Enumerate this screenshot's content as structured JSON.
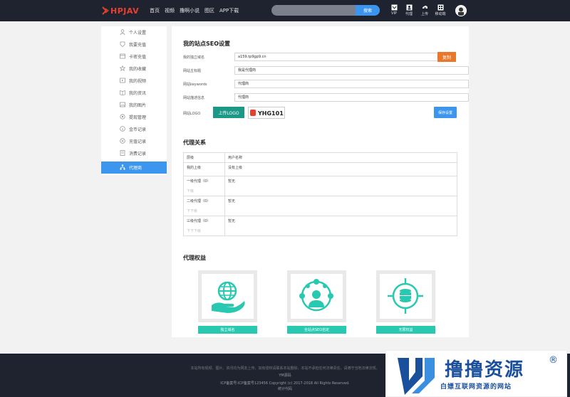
{
  "header": {
    "logo_text": "HPJAV",
    "nav": [
      "首页",
      "视频",
      "撸啊小说",
      "图区",
      "APP下载"
    ],
    "search": {
      "placeholder": "",
      "button_label": "搜索"
    },
    "tools": [
      {
        "icon": "vip-icon",
        "label": "VIP"
      },
      {
        "icon": "agent-icon",
        "label": "代理"
      },
      {
        "icon": "upload-icon",
        "label": "上传"
      },
      {
        "icon": "mobile-icon",
        "label": "移动端"
      }
    ]
  },
  "sidebar": {
    "items": [
      {
        "icon": "user-icon",
        "label": "个人设置"
      },
      {
        "icon": "vip-badge-icon",
        "label": "我要充值"
      },
      {
        "icon": "card-icon",
        "label": "卡密充值"
      },
      {
        "icon": "star-icon",
        "label": "我的收藏"
      },
      {
        "icon": "video-icon",
        "label": "我的视频"
      },
      {
        "icon": "book-icon",
        "label": "我的资讯"
      },
      {
        "icon": "image-icon",
        "label": "我的图片"
      },
      {
        "icon": "gear-icon",
        "label": "提现管理"
      },
      {
        "icon": "coin-icon",
        "label": "金币记录"
      },
      {
        "icon": "yen-icon",
        "label": "充值记录"
      },
      {
        "icon": "receipt-icon",
        "label": "消费记录"
      },
      {
        "icon": "network-icon",
        "label": "代理商"
      }
    ],
    "active_index": 11
  },
  "seo": {
    "title": "我的站点SEO设置",
    "fields": [
      {
        "label": "我的独立域名",
        "value": "a159.tp9gp9.cn"
      },
      {
        "label": "网站主标题",
        "value": "我是代理商"
      },
      {
        "label": "网站keywords",
        "value": "代理商"
      },
      {
        "label": "网站描述信息",
        "value": "代理商"
      }
    ],
    "copy_label": "复制",
    "logo_label": "网站LOGO",
    "upload_label": "上传LOGO",
    "logo_preview_text": "YHG101",
    "save_label": "保存设置"
  },
  "relation": {
    "title": "代理关系",
    "headers": [
      "层级",
      "用户名称"
    ],
    "rows": [
      {
        "level": "我的上级",
        "sub": "",
        "name": "没有上级"
      },
      {
        "level": "一级代理（0）",
        "sub": "下级",
        "name": "暂无"
      },
      {
        "level": "二级代理（0）",
        "sub": "下下级",
        "name": "暂无"
      },
      {
        "level": "三级代理（0）",
        "sub": "下下下级",
        "name": "暂无"
      }
    ]
  },
  "benefits": {
    "title": "代理权益",
    "cards": [
      {
        "icon": "globe-hand-icon",
        "label": "独立域名"
      },
      {
        "icon": "network-user-icon",
        "label": "全站点SEO自定"
      },
      {
        "icon": "database-target-icon",
        "label": "无限权益"
      }
    ]
  },
  "footer": {
    "lines": [
      "本站所有视频、图片、资讯均为网友上传，如有侵权请联系本站删除，本站不承担任何法律责任，请遵守当地法律法规。",
      "YM源码",
      "ICP备案号:ICP备案号123456   Copyright (c) 2017-2018 All Rights Reserved.",
      "统计代码"
    ]
  },
  "watermark": {
    "title": "撸撸资源",
    "subtitle": "白嫖互联网资源的网站",
    "reg": "®"
  },
  "colors": {
    "header_bg": "#1f2330",
    "accent_blue": "#3d96ee",
    "copy_orange": "#e9782a",
    "upload_green": "#1b9986",
    "teal": "#28c9b0",
    "brand_red": "#e8402e",
    "watermark_blue": "#1a4f9c"
  }
}
